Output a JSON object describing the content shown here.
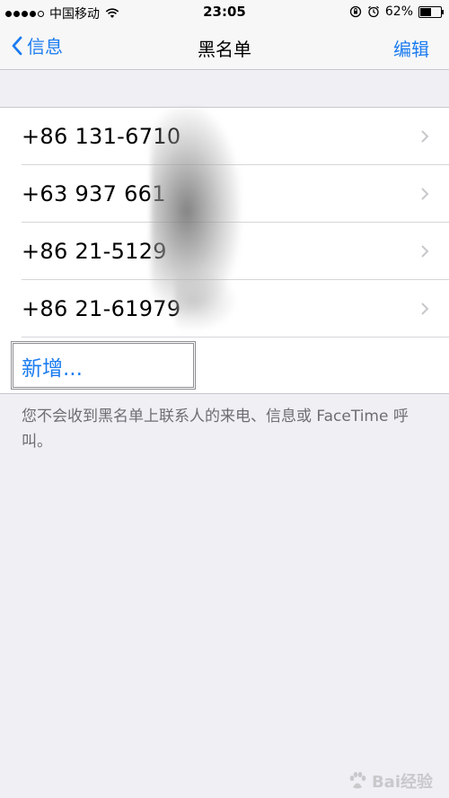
{
  "status_bar": {
    "carrier": "中国移动",
    "time": "23:05",
    "battery": "62%",
    "battery_level": 0.62
  },
  "nav": {
    "back_label": "信息",
    "title": "黑名单",
    "edit_label": "编辑"
  },
  "blocked_list": {
    "items": [
      {
        "number": "+86 131-6710"
      },
      {
        "number": "+63 937 661"
      },
      {
        "number": "+86 21-5129"
      },
      {
        "number": "+86 21-61979"
      }
    ],
    "add_label": "新增..."
  },
  "footer_note": "您不会收到黑名单上联系人的来电、信息或 FaceTime 呼叫。",
  "watermark": {
    "text": "Bai经验"
  },
  "colors": {
    "accent": "#1b7cf0",
    "background": "#efeff4"
  }
}
